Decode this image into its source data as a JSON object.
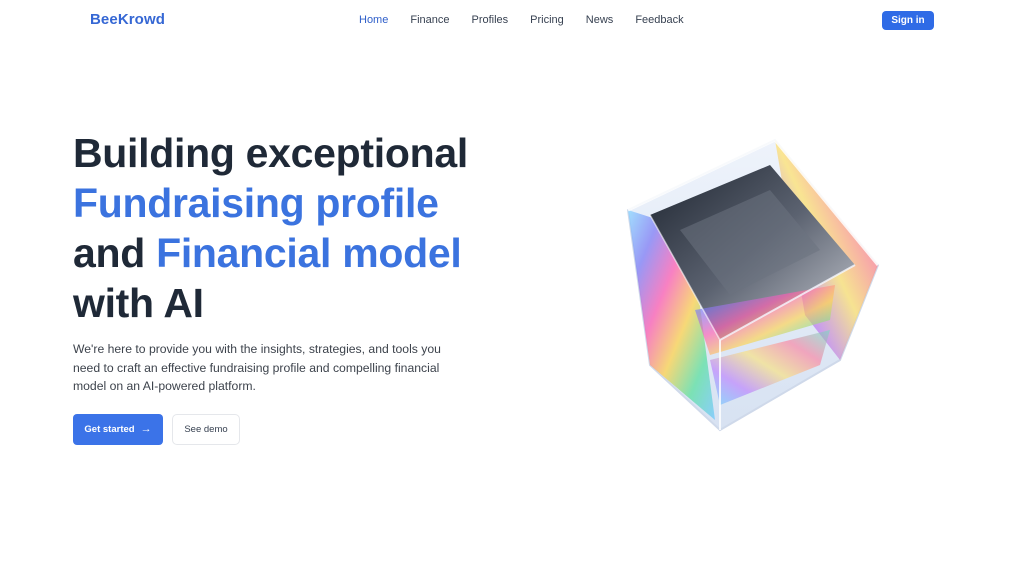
{
  "header": {
    "logo": "BeeKrowd",
    "nav": [
      {
        "label": "Home",
        "active": true
      },
      {
        "label": "Finance",
        "active": false
      },
      {
        "label": "Profiles",
        "active": false
      },
      {
        "label": "Pricing",
        "active": false
      },
      {
        "label": "News",
        "active": false
      },
      {
        "label": "Feedback",
        "active": false
      }
    ],
    "signin_label": "Sign in"
  },
  "hero": {
    "headline": {
      "line1": "Building exceptional",
      "line2": "Fundraising profile",
      "line3_plain": "and ",
      "line3_blue": "Financial model",
      "line4": "with AI"
    },
    "subtitle": {
      "line1": "We're here to provide you with the insights, strategies, and tools you",
      "line2": "need to craft an effective fundraising profile and compelling financial",
      "line3": "model on an AI-powered platform."
    },
    "primary_cta": {
      "label": "Get started",
      "icon": "arrow-right-icon"
    },
    "secondary_cta": {
      "label": "See demo"
    }
  },
  "illustration": {
    "name": "glass-cube-illustration"
  },
  "colors": {
    "brand": "#3567d4",
    "accent_blue": "#3b73df",
    "button_blue": "#2f6be6",
    "text_dark": "#1f2937"
  }
}
